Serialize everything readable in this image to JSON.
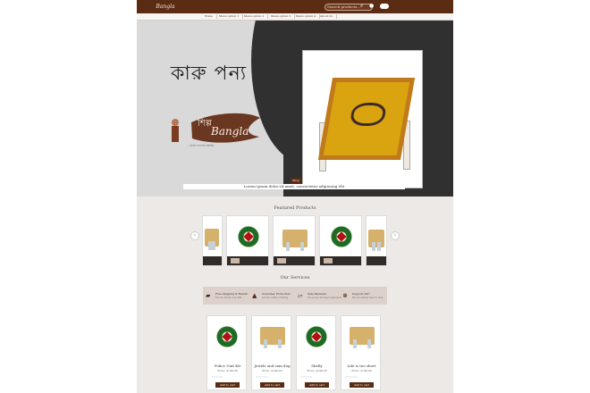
{
  "topbar": {
    "logo": "Bangla",
    "search_placeholder": "Search products...",
    "search_icon": "search-icon",
    "account_icon": "user-icon"
  },
  "nav": {
    "items": [
      "Home",
      "Menu option 1",
      "Menu option 2",
      "Menu option 3",
      "Menu option 4",
      "About Us"
    ]
  },
  "hero": {
    "title": "কারু পন্য",
    "logo_main": "Bangla",
    "logo_sub": "শিল্প",
    "tagline": "...ঐতিহ্য বাংলার হস্তশিল্প",
    "tag": "Shop",
    "description": "Lorem ipsum dolor sit amet, consectetur adipiscing elit"
  },
  "featured": {
    "title": "Featured Products",
    "prev": "‹",
    "next": "›"
  },
  "services": {
    "title": "Our Services",
    "items": [
      {
        "title": "Free shipping & Return",
        "text": "For all orders over $99",
        "icon": "truck-icon"
      },
      {
        "title": "Customer Protection",
        "text": "Secure online ordering",
        "icon": "thumbs-up-icon"
      },
      {
        "title": "Safe Payment",
        "text": "We accept all major payments",
        "icon": "card-icon"
      },
      {
        "title": "Support 24/7",
        "text": "We are always here to help",
        "icon": "support-icon"
      }
    ]
  },
  "products": [
    {
      "name": "Police Unit Kit",
      "price": "Price: $149.00",
      "button": "Add to cart"
    },
    {
      "name": "Jewels and sam dog",
      "price": "Price: $149.00",
      "button": "Add to cart"
    },
    {
      "name": "Shelly",
      "price": "Price: $149.00",
      "button": "Add to cart"
    },
    {
      "name": "Life is too short",
      "price": "Price: $149.00",
      "button": "Add to cart"
    }
  ],
  "colors": {
    "brand": "#5a2c14",
    "hero_dark": "#303030",
    "background": "#ede9e6"
  }
}
